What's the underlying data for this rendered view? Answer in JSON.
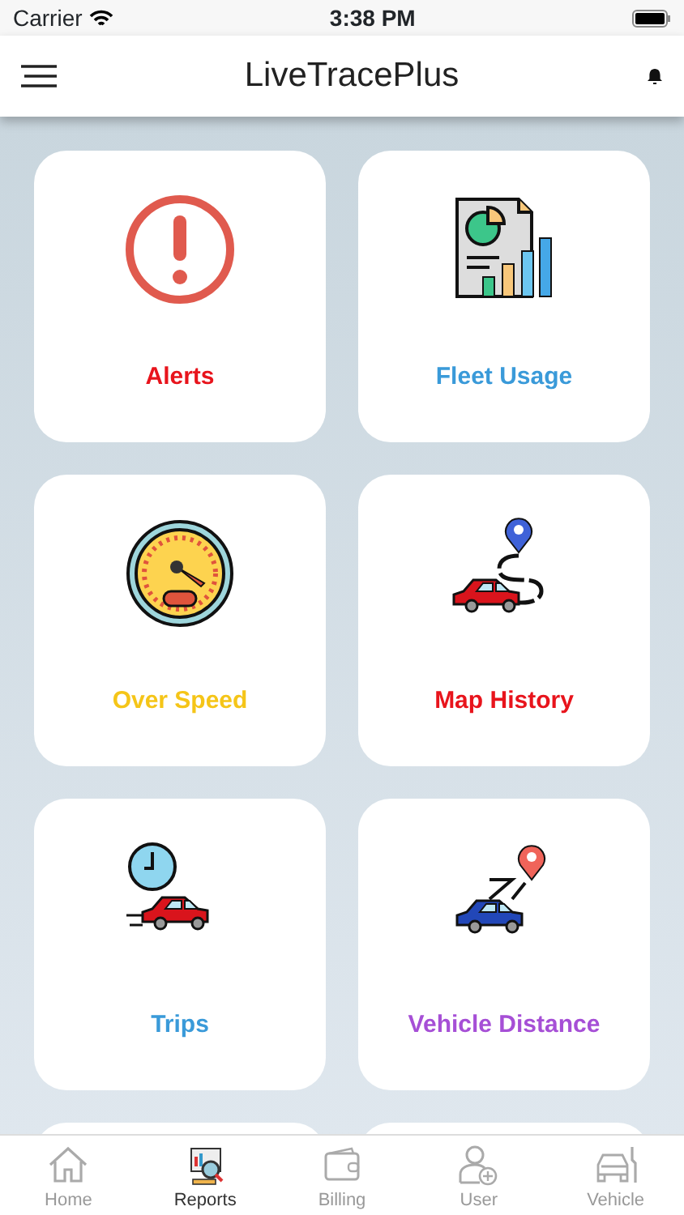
{
  "status_bar": {
    "carrier": "Carrier",
    "time": "3:38 PM"
  },
  "header": {
    "title": "LiveTracePlus"
  },
  "tiles": [
    {
      "label": "Alerts",
      "color": "#e8141c",
      "kind": "alert"
    },
    {
      "label": "Fleet Usage",
      "color": "#3a9ad9",
      "kind": "report"
    },
    {
      "label": "Over Speed",
      "color": "#f5c518",
      "kind": "speedometer"
    },
    {
      "label": "Map History",
      "color": "#e8141c",
      "kind": "route"
    },
    {
      "label": "Trips",
      "color": "#3a9ad9",
      "kind": "trip"
    },
    {
      "label": "Vehicle Distance",
      "color": "#a64fd6",
      "kind": "distance"
    }
  ],
  "tab_bar": [
    {
      "label": "Home",
      "kind": "home",
      "selected": false
    },
    {
      "label": "Reports",
      "kind": "reports",
      "selected": true
    },
    {
      "label": "Billing",
      "kind": "wallet",
      "selected": false
    },
    {
      "label": "User",
      "kind": "user",
      "selected": false
    },
    {
      "label": "Vehicle",
      "kind": "vehicle",
      "selected": false
    }
  ]
}
